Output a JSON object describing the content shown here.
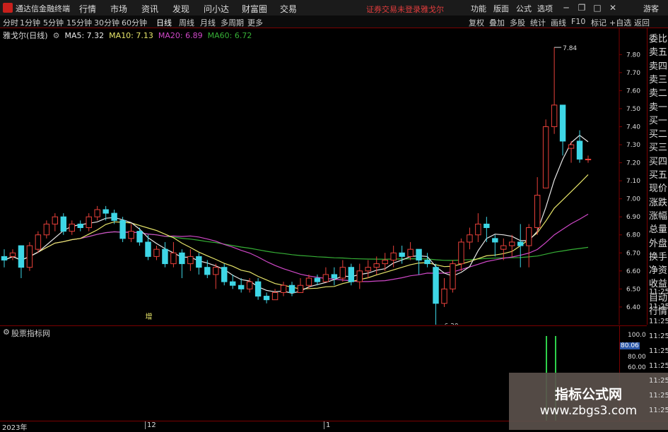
{
  "titlebar": {
    "app_name": "通达信金融终端",
    "menus": [
      "行情",
      "市场",
      "资讯",
      "发现",
      "问小达",
      "财富圈",
      "交易"
    ],
    "warning": "证券交易未登录",
    "stock_short": "雅戈尔",
    "right_menus": [
      "功能",
      "版面",
      "公式",
      "选项"
    ],
    "guest": "游客"
  },
  "periods": [
    "分时",
    "1分钟",
    "5分钟",
    "15分钟",
    "30分钟",
    "60分钟",
    "日线",
    "周线",
    "月线",
    "多周期",
    "更多"
  ],
  "active_period": "日线",
  "toolbar": [
    "复权",
    "叠加",
    "多股",
    "统计",
    "画线",
    "F10",
    "标记",
    "+自选",
    "返回"
  ],
  "legend": {
    "stock": "雅戈尔(日线)",
    "ma5": "MA5: 7.32",
    "ma10": "MA10: 7.13",
    "ma20": "MA20: 6.89",
    "ma60": "MA60: 6.72"
  },
  "colors": {
    "up": "#e8403a",
    "down": "#3ed6e6",
    "ma5": "#e8e8e8",
    "ma10": "#e8e66a",
    "ma20": "#d048c8",
    "ma60": "#36b036",
    "axis_red": "#7a0000"
  },
  "chart_data": {
    "type": "candlestick",
    "y_ticks": [
      "7.80",
      "7.70",
      "7.60",
      "7.50",
      "7.40",
      "7.30",
      "7.20",
      "7.10",
      "7.00",
      "6.90",
      "6.80",
      "6.70",
      "6.60",
      "6.50",
      "6.40"
    ],
    "ylim": [
      6.38,
      7.86
    ],
    "high_label": "7.84",
    "low_label": "6.30",
    "annotation": "增",
    "candles": [
      [
        6.68,
        6.66,
        6.72,
        6.62
      ],
      [
        6.68,
        6.7,
        6.72,
        6.66
      ],
      [
        6.74,
        6.62,
        6.74,
        6.56
      ],
      [
        6.62,
        6.74,
        6.76,
        6.6
      ],
      [
        6.72,
        6.8,
        6.82,
        6.7
      ],
      [
        6.8,
        6.86,
        6.88,
        6.78
      ],
      [
        6.86,
        6.9,
        6.92,
        6.82
      ],
      [
        6.9,
        6.82,
        6.92,
        6.8
      ],
      [
        6.82,
        6.86,
        6.88,
        6.8
      ],
      [
        6.86,
        6.84,
        6.88,
        6.82
      ],
      [
        6.84,
        6.9,
        6.92,
        6.82
      ],
      [
        6.9,
        6.94,
        6.96,
        6.88
      ],
      [
        6.94,
        6.92,
        6.96,
        6.88
      ],
      [
        6.92,
        6.88,
        6.94,
        6.86
      ],
      [
        6.88,
        6.78,
        6.9,
        6.76
      ],
      [
        6.78,
        6.82,
        6.86,
        6.76
      ],
      [
        6.82,
        6.76,
        6.84,
        6.74
      ],
      [
        6.76,
        6.68,
        6.8,
        6.66
      ],
      [
        6.68,
        6.72,
        6.74,
        6.66
      ],
      [
        6.72,
        6.64,
        6.76,
        6.62
      ],
      [
        6.64,
        6.7,
        6.76,
        6.62
      ],
      [
        6.7,
        6.64,
        6.72,
        6.56
      ],
      [
        6.64,
        6.68,
        6.72,
        6.6
      ],
      [
        6.68,
        6.62,
        6.7,
        6.58
      ],
      [
        6.62,
        6.58,
        6.66,
        6.56
      ],
      [
        6.58,
        6.62,
        6.64,
        6.5
      ],
      [
        6.62,
        6.54,
        6.64,
        6.52
      ],
      [
        6.54,
        6.52,
        6.58,
        6.5
      ],
      [
        6.52,
        6.5,
        6.56,
        6.48
      ],
      [
        6.5,
        6.54,
        6.56,
        6.48
      ],
      [
        6.54,
        6.46,
        6.56,
        6.44
      ],
      [
        6.46,
        6.44,
        6.48,
        6.42
      ],
      [
        6.44,
        6.48,
        6.5,
        6.44
      ],
      [
        6.48,
        6.52,
        6.54,
        6.46
      ],
      [
        6.52,
        6.48,
        6.54,
        6.46
      ],
      [
        6.48,
        6.52,
        6.56,
        6.48
      ],
      [
        6.52,
        6.56,
        6.58,
        6.5
      ],
      [
        6.56,
        6.54,
        6.58,
        6.52
      ],
      [
        6.54,
        6.58,
        6.62,
        6.54
      ],
      [
        6.58,
        6.56,
        6.62,
        6.52
      ],
      [
        6.56,
        6.62,
        6.66,
        6.54
      ],
      [
        6.62,
        6.54,
        6.64,
        6.52
      ],
      [
        6.54,
        6.6,
        6.64,
        6.5
      ],
      [
        6.6,
        6.62,
        6.66,
        6.56
      ],
      [
        6.62,
        6.64,
        6.68,
        6.58
      ],
      [
        6.64,
        6.66,
        6.7,
        6.6
      ],
      [
        6.66,
        6.7,
        6.74,
        6.62
      ],
      [
        6.7,
        6.68,
        6.74,
        6.64
      ],
      [
        6.68,
        6.72,
        6.76,
        6.66
      ],
      [
        6.72,
        6.66,
        6.72,
        6.58
      ],
      [
        6.66,
        6.64,
        6.7,
        6.62
      ],
      [
        6.62,
        6.42,
        6.64,
        6.3
      ],
      [
        6.42,
        6.5,
        6.56,
        6.4
      ],
      [
        6.5,
        6.64,
        6.66,
        6.48
      ],
      [
        6.64,
        6.76,
        6.78,
        6.6
      ],
      [
        6.76,
        6.8,
        6.84,
        6.72
      ],
      [
        6.8,
        6.86,
        6.92,
        6.76
      ],
      [
        6.86,
        6.84,
        6.9,
        6.76
      ],
      [
        6.78,
        6.76,
        6.8,
        6.68
      ],
      [
        6.72,
        6.74,
        6.78,
        6.66
      ],
      [
        6.74,
        6.76,
        6.8,
        6.68
      ],
      [
        6.76,
        6.74,
        6.86,
        6.62
      ],
      [
        6.74,
        6.84,
        6.86,
        6.62
      ],
      [
        6.84,
        7.02,
        7.12,
        6.8
      ],
      [
        7.06,
        7.4,
        7.44,
        7.06
      ],
      [
        7.4,
        7.52,
        7.84,
        7.36
      ],
      [
        7.52,
        7.32,
        7.52,
        7.24
      ],
      [
        7.28,
        7.3,
        7.32,
        7.2
      ],
      [
        7.32,
        7.22,
        7.38,
        7.2
      ],
      [
        7.22,
        7.22,
        7.24,
        7.2
      ]
    ]
  },
  "quote_panel": [
    "委比",
    "卖五",
    "卖四",
    "卖三",
    "卖二",
    "卖一",
    "买一",
    "买二",
    "买三",
    "买四",
    "买五",
    "现价",
    "涨跌",
    "涨幅",
    "总量",
    "外盘",
    "换手",
    "净资",
    "收益",
    "自动",
    "行情"
  ],
  "quote_times": [
    "11:25",
    "11:25",
    "11:25",
    "11:25",
    "11:25",
    "11:25",
    "11:25",
    "11:25",
    "11:25"
  ],
  "indicator": {
    "name": "股票指标网",
    "ticks": [
      "100.0",
      "80.00",
      "60.00"
    ],
    "current": "80.06"
  },
  "bottom_axis": [
    "2023年",
    "12",
    "1"
  ],
  "watermark": {
    "title": "指标公式网",
    "url": "www.zbgs3.com"
  }
}
